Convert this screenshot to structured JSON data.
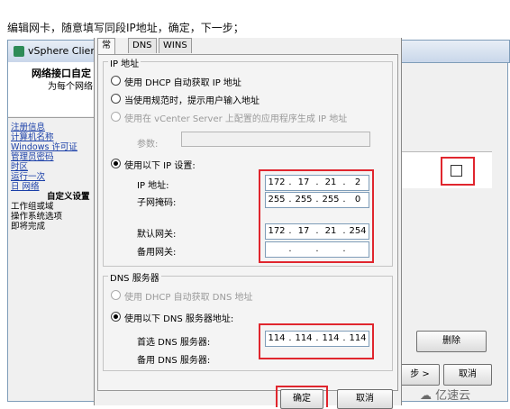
{
  "caption": "编辑网卡，随意填写同段IP地址，确定，下一步；",
  "background_window": {
    "title": "vSphere Clien",
    "header_title": "网络接口自定",
    "header_subtitle": "为每个网络",
    "nav": [
      {
        "label": "注册信息",
        "link": true
      },
      {
        "label": "计算机名称",
        "link": true
      },
      {
        "label": "Windows 许可证",
        "link": true
      },
      {
        "label": "管理员密码",
        "link": true
      },
      {
        "label": "时区",
        "link": true
      },
      {
        "label": "运行一次",
        "link": true
      },
      {
        "label": "日 网络",
        "link": true
      },
      {
        "label": "自定义设置",
        "link": false,
        "bold": true
      },
      {
        "label": "工作组或域",
        "link": false
      },
      {
        "label": "操作系统选项",
        "link": false
      },
      {
        "label": "即将完成",
        "link": false
      }
    ],
    "delete_button": "删除",
    "next_button": "步 >",
    "cancel_button": "取消"
  },
  "dialog": {
    "tabs": [
      "常规",
      "DNS",
      "WINS"
    ],
    "active_tab": "常规",
    "ip_group_title": "IP 地址",
    "ip_options": [
      {
        "label": "使用 DHCP 自动获取 IP 地址",
        "selected": false,
        "disabled": false
      },
      {
        "label": "当使用规范时，提示用户输入地址",
        "selected": false,
        "disabled": false
      },
      {
        "label": "使用在 vCenter Server 上配置的应用程序生成 IP 地址",
        "selected": false,
        "disabled": true
      }
    ],
    "params_label": "参数:",
    "static_ip_label": "使用以下 IP 设置:",
    "ip_address_label": "IP 地址:",
    "ip_address": [
      "172",
      "17",
      "21",
      "2"
    ],
    "subnet_label": "子网掩码:",
    "subnet": [
      "255",
      "255",
      "255",
      "0"
    ],
    "gateway_label": "默认网关:",
    "gateway": [
      "172",
      "17",
      "21",
      "254"
    ],
    "alt_gateway_label": "备用网关:",
    "alt_gateway": [
      "",
      "",
      "",
      ""
    ],
    "dns_group_title": "DNS 服务器",
    "dns_auto_label": "使用 DHCP 自动获取 DNS 地址",
    "dns_manual_label": "使用以下 DNS 服务器地址:",
    "preferred_dns_label": "首选 DNS 服务器:",
    "preferred_dns": [
      "114",
      "114",
      "114",
      "114"
    ],
    "alternate_dns_label": "备用 DNS 服务器:",
    "ok_button": "确定",
    "cancel_button": "取消"
  },
  "watermark": "亿速云",
  "colors": {
    "highlight": "#e0262e",
    "link": "#1a3fa8"
  }
}
